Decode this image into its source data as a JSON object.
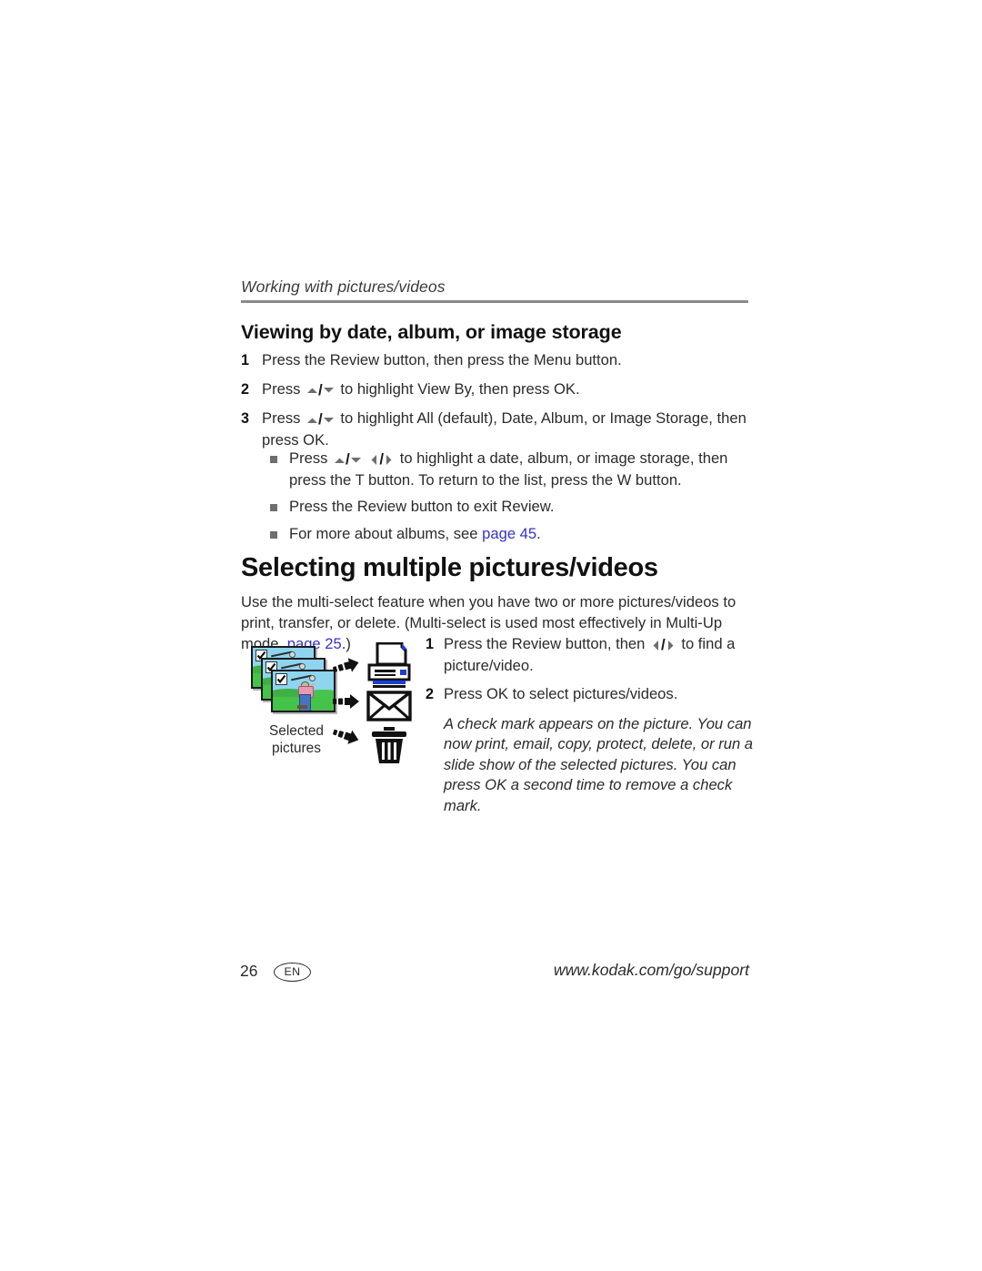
{
  "document": {
    "running_header": "Working with pictures/videos",
    "section_heading": "Viewing by date, album, or image storage",
    "numbered_steps": [
      {
        "num": "1",
        "pre": "Press the Review button, then press the Menu button.",
        "icons": [],
        "post": ""
      },
      {
        "num": "2",
        "pre": "Press ",
        "icons": [
          "updown"
        ],
        "post": " to highlight View By, then press OK."
      },
      {
        "num": "3",
        "pre": "Press ",
        "icons": [
          "updown"
        ],
        "post": " to highlight All (default), Date, Album, or Image Storage, then press OK."
      }
    ],
    "bullets": [
      {
        "pre": "Press ",
        "icons": [
          "updown",
          "leftright"
        ],
        "post": " to highlight a date, album, or image storage, then press the T button. To return to the list, press the W button.",
        "link_text": "",
        "link_page": ""
      },
      {
        "pre": "Press the Review button to exit Review.",
        "icons": [],
        "post": "",
        "link_text": "",
        "link_page": ""
      },
      {
        "pre": "For more about albums, see ",
        "icons": [],
        "post": ".",
        "link_text": "page 45",
        "link_page": "45"
      }
    ],
    "big_heading": "Selecting multiple pictures/videos",
    "intro_part1": "Use the multi-select feature when you have two or more pictures/videos to print, transfer, or delete. (Multi-select is used most effectively in Multi-Up mode, ",
    "intro_link": "page 25",
    "intro_part2": ".)",
    "figure": {
      "caption_line1": "Selected",
      "caption_line2": "pictures",
      "photo_count": 3,
      "destinations": [
        {
          "name": "printer",
          "label": "printer-icon"
        },
        {
          "name": "email",
          "label": "envelope-icon"
        },
        {
          "name": "delete",
          "label": "trash-icon"
        }
      ],
      "accent_color": "#1b3fd0"
    },
    "steps_right": [
      {
        "num": "1",
        "pre": "Press the Review button, then ",
        "icons": [
          "leftright"
        ],
        "post": " to find a picture/video."
      },
      {
        "num": "2",
        "pre": "Press OK to select pictures/videos.",
        "icons": [],
        "post": ""
      }
    ],
    "note": "A check mark appears on the picture. You can now print, email, copy, protect, delete, or run a slide show of the selected pictures. You can press OK a second time to remove a check mark.",
    "footer": {
      "page_number": "26",
      "language": "EN",
      "url": "www.kodak.com/go/support"
    },
    "colors": {
      "link": "#3333cc",
      "rule": "#8a8a8a",
      "bullet": "#6d6e71",
      "text": "#2b2b2b"
    }
  }
}
